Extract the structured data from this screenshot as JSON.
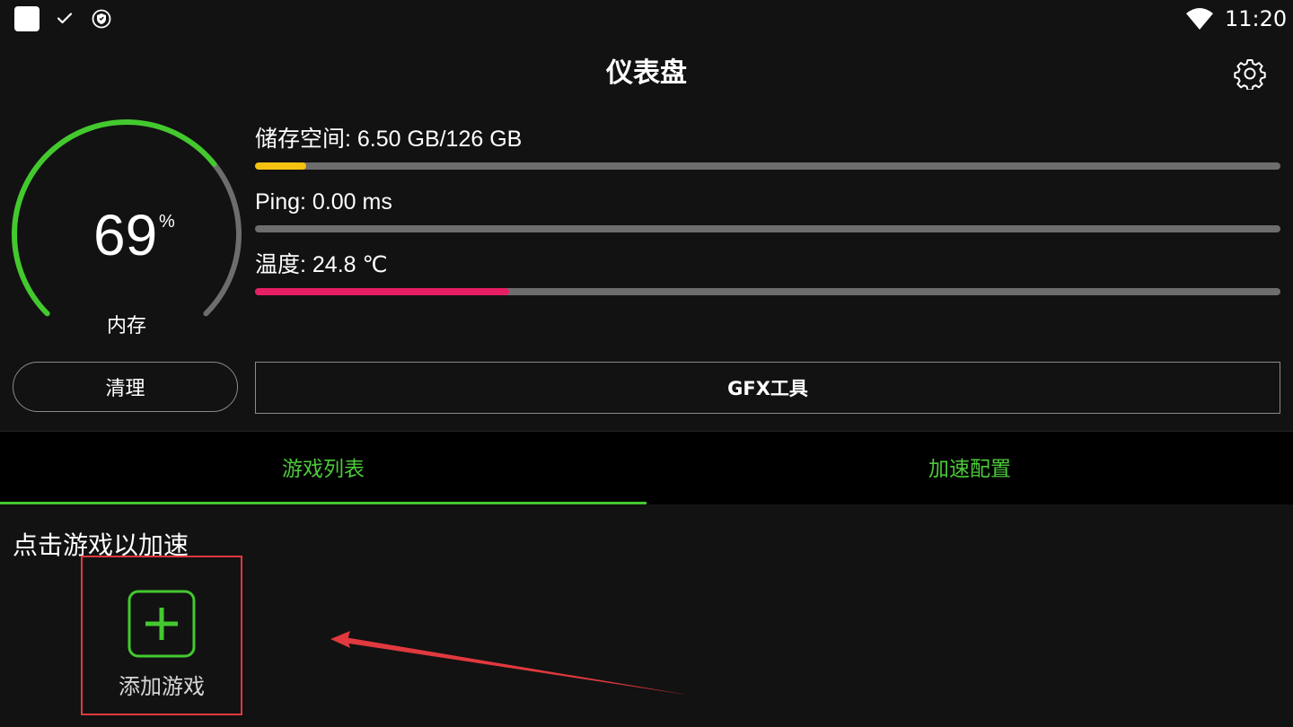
{
  "status_bar": {
    "time": "11:20",
    "icons": [
      "app-icon",
      "check-icon",
      "shield-icon",
      "wifi-icon"
    ]
  },
  "header": {
    "title": "仪表盘",
    "settings_icon": "gear-icon"
  },
  "memory_gauge": {
    "value": "69",
    "unit": "%",
    "label": "内存",
    "fraction": 0.69,
    "color_used": "#43c92e",
    "color_rest": "#6d6d6d"
  },
  "stats": {
    "storage": {
      "label": "储存空间: 6.50 GB/126 GB",
      "fraction": 0.05,
      "color": "#f5c211"
    },
    "ping": {
      "label": "Ping: 0.00 ms",
      "fraction": 0.0,
      "color": "#43c92e"
    },
    "temperature": {
      "label": "温度: 24.8 ℃",
      "fraction": 0.248,
      "color": "#e61e63"
    }
  },
  "actions": {
    "clean_label": "清理",
    "gfx_label": "GFX工具"
  },
  "tabs": {
    "items": [
      {
        "label": "游戏列表",
        "active": true
      },
      {
        "label": "加速配置",
        "active": false
      }
    ],
    "accent": "#43c92e"
  },
  "game_list": {
    "hint": "点击游戏以加速",
    "add_label": "添加游戏",
    "add_icon": "plus-icon"
  },
  "annotation": {
    "highlight_color": "#e0393e"
  }
}
